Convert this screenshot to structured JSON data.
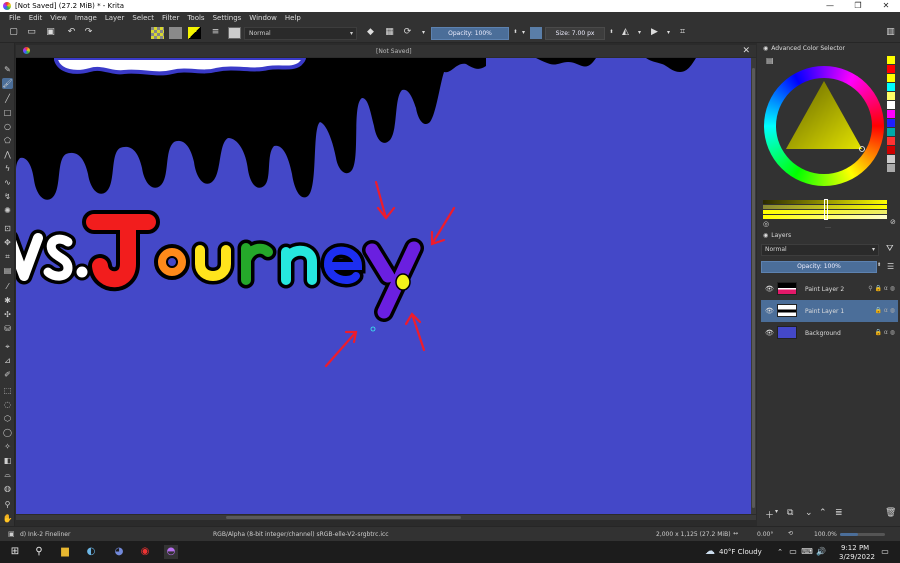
{
  "window": {
    "title": "[Not Saved]  (27.2 MiB) * - Krita",
    "controls": [
      "—",
      "❐",
      "✕"
    ]
  },
  "menu": [
    "File",
    "Edit",
    "View",
    "Image",
    "Layer",
    "Select",
    "Filter",
    "Tools",
    "Settings",
    "Window",
    "Help"
  ],
  "toolbar": {
    "brush_preset": "Normal",
    "opacity": "Opacity: 100%",
    "size": "Size: 7.00 px"
  },
  "document": {
    "tab_title": "[Not Saved]",
    "artwork_text": "vs.Journey"
  },
  "color_panel": {
    "title": "Advanced Color Selector",
    "palette": [
      "#ffff00",
      "#ff0000",
      "#ffff00",
      "#00ffff",
      "#ffff66",
      "#ffffff",
      "#ff00ff",
      "#2020ff",
      "#00aaaa",
      "#ff3333",
      "#cc0000",
      "#cccccc",
      "#aaaaaa"
    ]
  },
  "layers_panel": {
    "title": "Layers",
    "blend_mode": "Normal",
    "opacity": "Opacity:  100%",
    "layers": [
      {
        "name": "Paint Layer 2",
        "selected": false
      },
      {
        "name": "Paint Layer 1",
        "selected": true
      },
      {
        "name": "Background",
        "selected": false
      }
    ]
  },
  "status": {
    "brush": "d) Ink-2 Fineliner",
    "color_profile": "RGB/Alpha (8-bit integer/channel)  sRGB-elle-V2-srgbtrc.icc",
    "dimensions": "2,000 x 1,125 (27.2 MiB)",
    "rotation": "0.00°",
    "zoom": "100.0%"
  },
  "taskbar": {
    "weather": "40°F  Cloudy",
    "time": "9:12 PM",
    "date": "3/29/2022"
  }
}
